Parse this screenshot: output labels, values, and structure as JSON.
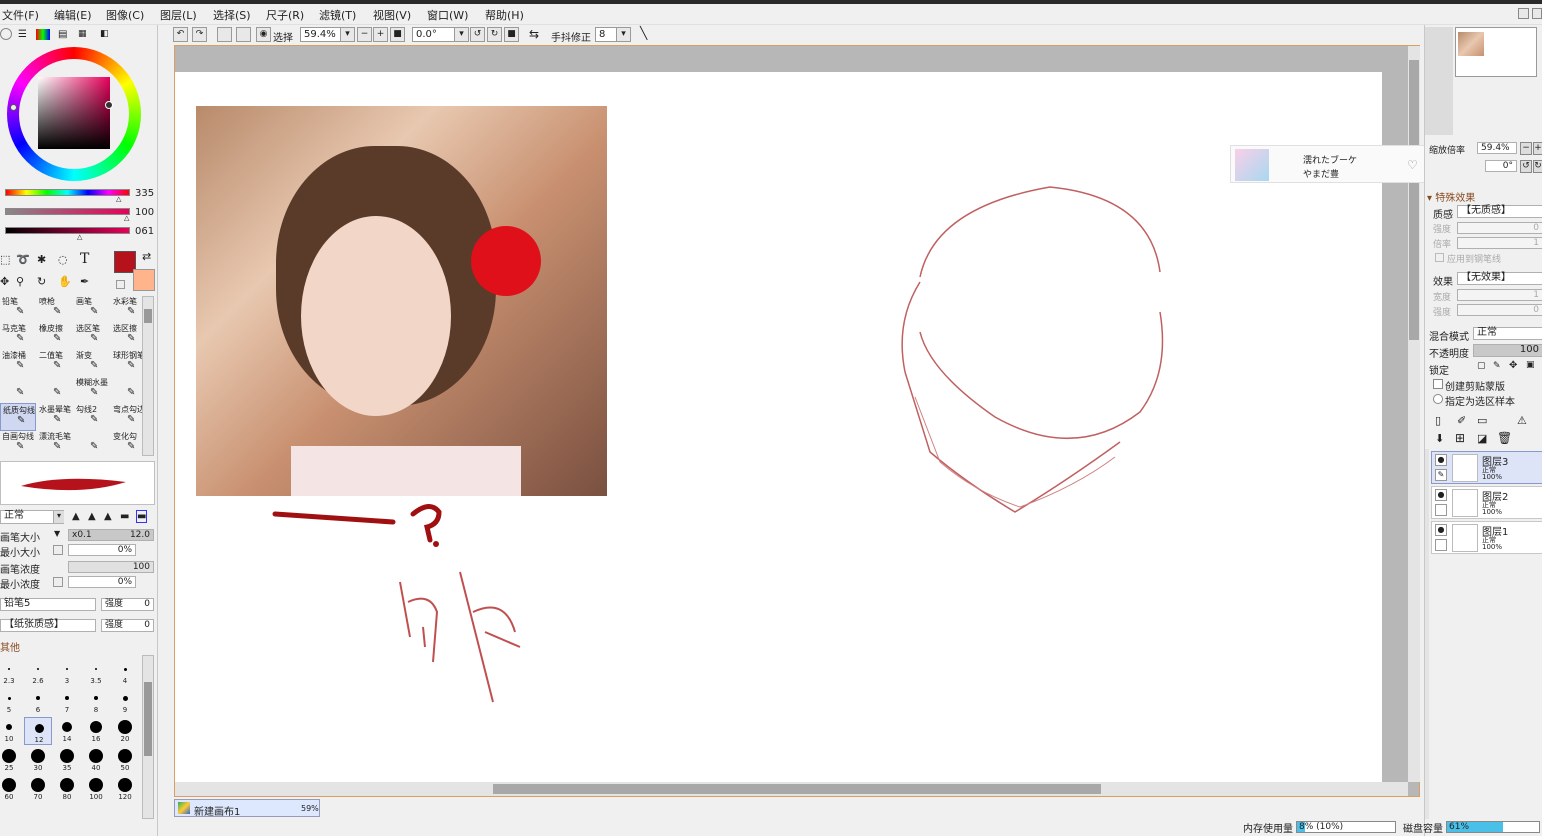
{
  "menu": [
    "文件(F)",
    "编辑(E)",
    "图像(C)",
    "图层(L)",
    "选择(S)",
    "尺子(R)",
    "滤镜(T)",
    "视图(V)",
    "窗口(W)",
    "帮助(H)"
  ],
  "toolbar": {
    "select_label": "选择",
    "zoom": "59.4%",
    "rotation": "0.0°",
    "stabilizer_label": "手抖修正",
    "stabilizer_value": "8"
  },
  "color": {
    "current": "#b5121b",
    "secondary": "#ffb48c",
    "h": "335",
    "s": "100",
    "v": "061"
  },
  "tools": [
    [
      "铅笔",
      "喷枪",
      "画笔",
      "水彩笔"
    ],
    [
      "马克笔",
      "橡皮擦",
      "选区笔",
      "选区擦"
    ],
    [
      "油漆桶",
      "二值笔",
      "渐变",
      "球形钢笔"
    ],
    [
      "",
      "",
      "模糊水墨",
      ""
    ],
    [
      "纸质勾线",
      "水墨晕笔",
      "勾线2",
      "弯点勾边"
    ],
    [
      "自画勾线",
      "漂流毛笔",
      "",
      "变化勾"
    ]
  ],
  "brush": {
    "blend_mode": "正常",
    "size_label": "画笔大小",
    "size_mult": "x0.1",
    "size_value": "12.0",
    "min_size_label": "最小大小",
    "min_size_value": "0%",
    "density_label": "画笔浓度",
    "density_value": "100",
    "min_density_label": "最小浓度",
    "min_density_value": "0%",
    "shape": "铅笔5",
    "shape_strength_label": "强度",
    "shape_strength": "0",
    "texture": "【纸张质感】",
    "texture_strength_label": "强度",
    "texture_strength": "0",
    "other_label": "其他"
  },
  "brush_sizes": [
    "2.3",
    "2.6",
    "3",
    "3.5",
    "4",
    "5",
    "6",
    "7",
    "8",
    "9",
    "10",
    "12",
    "14",
    "16",
    "20",
    "25",
    "30",
    "35",
    "40",
    "50",
    "60",
    "70",
    "80",
    "100",
    "120"
  ],
  "canvas_tab": {
    "name": "新建画布1",
    "zoom": "59%"
  },
  "music_popup": {
    "title": "濡れたブーケ",
    "artist": "やまだ豊"
  },
  "navigator": {
    "zoom_label": "缩放倍率",
    "zoom": "59.4%",
    "rotation": "0°"
  },
  "layer_props": {
    "special_effects": "特殊效果",
    "texture_label": "质感",
    "texture_value": "【无质感】",
    "strength_label": "强度",
    "strength_value": "0",
    "scale_label": "倍率",
    "scale_value": "1",
    "apply_pen_label": "应用到钢笔线",
    "effect_label": "效果",
    "effect_value": "【无效果】",
    "width_label": "宽度",
    "width_value": "1",
    "eff_strength_label": "强度",
    "eff_strength_value": "0",
    "blend_label": "混合模式",
    "blend_value": "正常",
    "opacity_label": "不透明度",
    "opacity_value": "100",
    "lock_label": "锁定",
    "clip_label": "创建剪贴蒙版",
    "sample_label": "指定为选区样本"
  },
  "layers": [
    {
      "name": "图层3",
      "mode": "正常",
      "opacity": "100%"
    },
    {
      "name": "图层2",
      "mode": "正常",
      "opacity": "100%"
    },
    {
      "name": "图层1",
      "mode": "正常",
      "opacity": "100%"
    }
  ],
  "status": {
    "memory_label": "内存使用量",
    "memory_value": "8% (10%)",
    "memory_fraction": 0.08,
    "disk_label": "磁盘容量",
    "disk_value": "61%",
    "disk_fraction": 0.61
  }
}
